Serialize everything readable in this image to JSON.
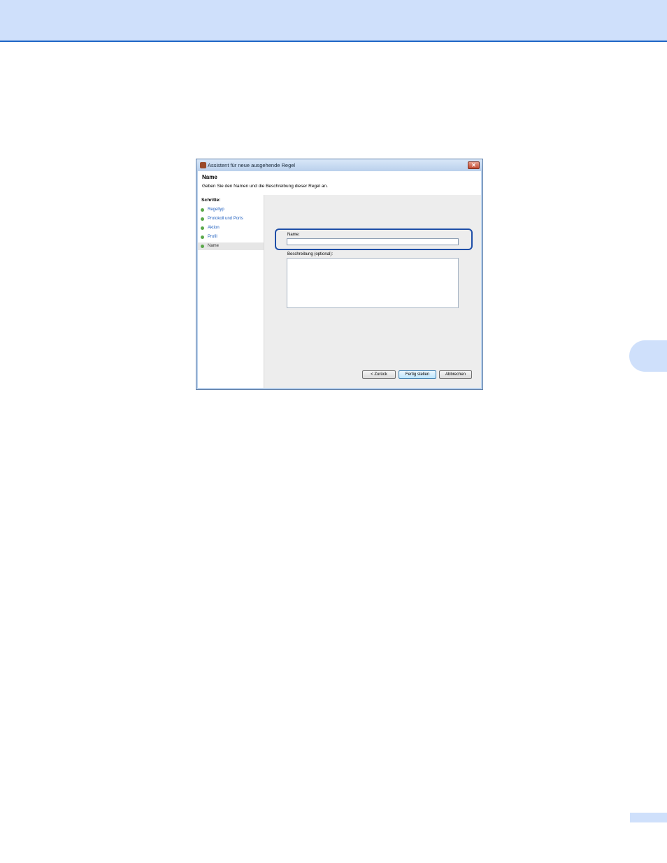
{
  "dialog": {
    "title": "Assistent für neue ausgehende Regel",
    "close_label": "✕",
    "header_title": "Name",
    "header_subtitle": "Geben Sie den Namen und die Beschreibung dieser Regel an."
  },
  "steps": {
    "heading": "Schritte:",
    "items": [
      {
        "label": "Regeltyp"
      },
      {
        "label": "Protokoll und Ports"
      },
      {
        "label": "Aktion"
      },
      {
        "label": "Profil"
      },
      {
        "label": "Name",
        "active": true
      }
    ]
  },
  "form": {
    "name_label": "Name:",
    "name_value": "",
    "description_label": "Beschreibung (optional):",
    "description_value": ""
  },
  "buttons": {
    "back": "< Zurück",
    "finish": "Fertig stellen",
    "cancel": "Abbrechen"
  },
  "colors": {
    "page_band": "#cfe0fb",
    "band_rule": "#1f66c6",
    "highlight": "#1f4fa8",
    "step_link": "#1f5fbf",
    "step_dot": "#5aa84a"
  },
  "icons": {
    "title": "firewall-icon",
    "close": "close-icon",
    "step": "green-dot-icon"
  }
}
